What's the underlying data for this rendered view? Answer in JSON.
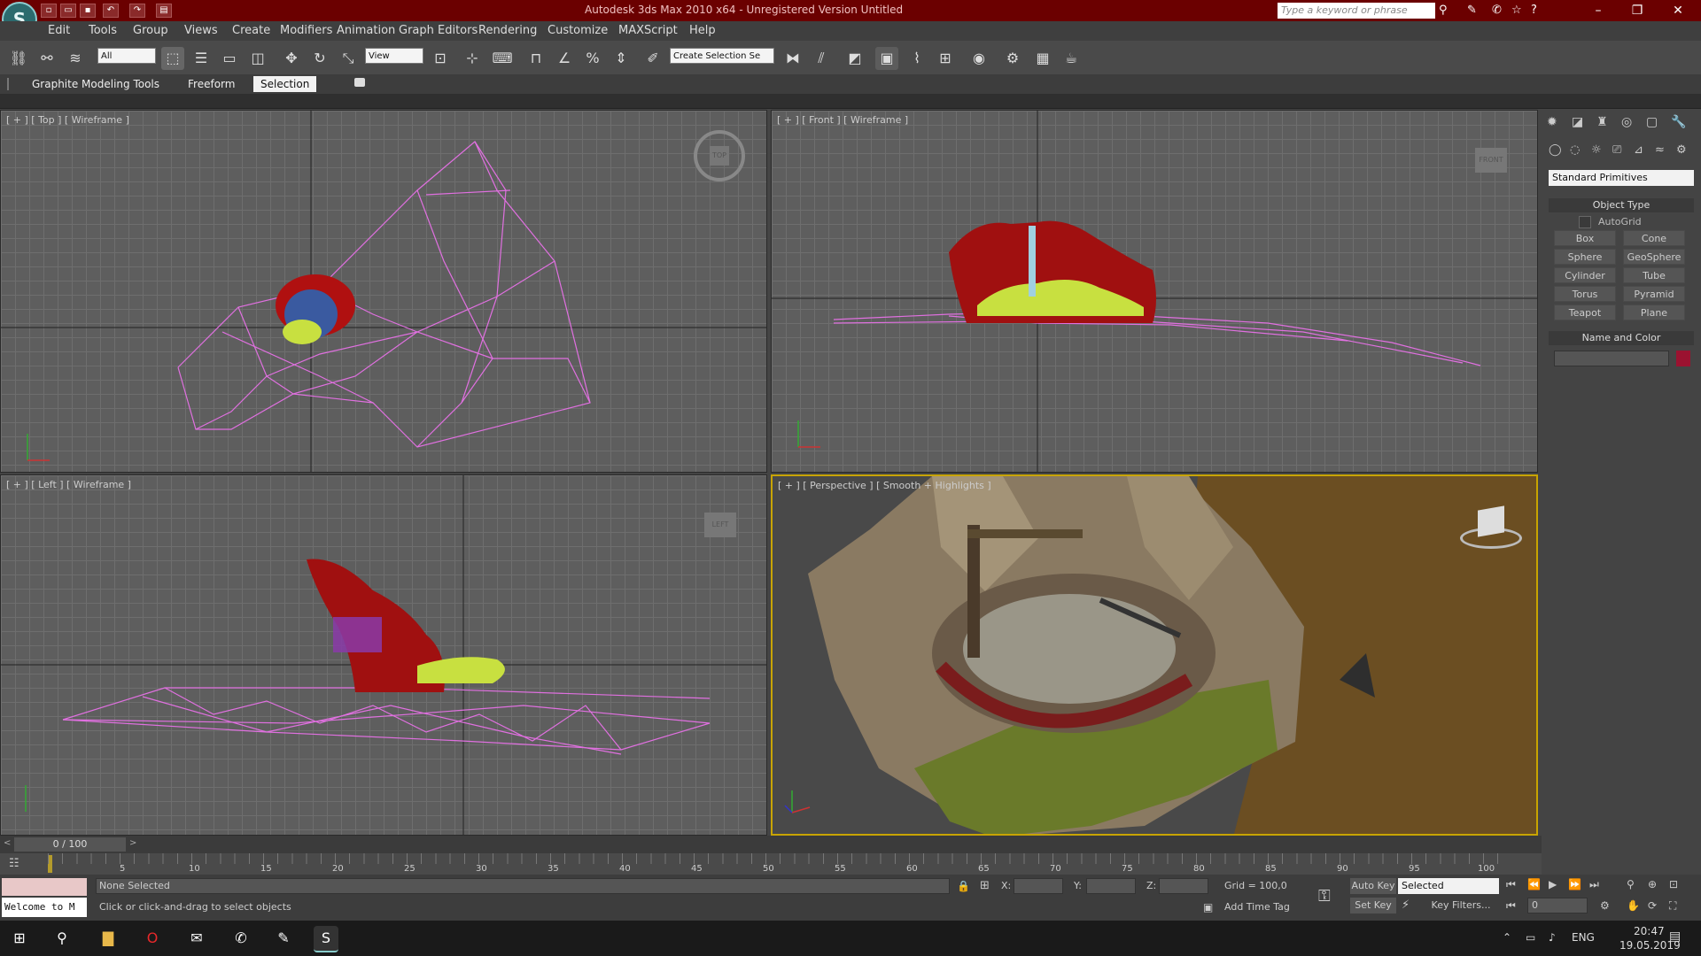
{
  "app": {
    "title": "Autodesk 3ds Max  2010 x64  -  Unregistered Version    Untitled",
    "logo": "S",
    "search_placeholder": "Type a keyword or phrase"
  },
  "window_controls": {
    "minimize": "–",
    "maximize": "❐",
    "close": "✕"
  },
  "menu": [
    "Edit",
    "Tools",
    "Group",
    "Views",
    "Create",
    "Modifiers",
    "Animation",
    "Graph Editors",
    "Rendering",
    "Customize",
    "MAXScript",
    "Help"
  ],
  "toolbar": {
    "filter_value": "All",
    "refcoord_value": "View",
    "named_selection_placeholder": "Create Selection Se"
  },
  "ribbon": {
    "tabs": [
      "Graphite Modeling Tools",
      "Freeform",
      "Selection"
    ],
    "active_tab": "Selection"
  },
  "viewports": {
    "top": "[ + ] [ Top ] [ Wireframe ]",
    "front": "[ + ] [ Front ] [ Wireframe ]",
    "left": "[ + ] [ Left ] [ Wireframe ]",
    "perspective": "[ + ] [ Perspective ] [ Smooth + Highlights ]",
    "cube_top": "TOP",
    "cube_front": "FRONT",
    "cube_left": "LEFT"
  },
  "command_panel": {
    "category": "Standard Primitives",
    "object_type_header": "Object Type",
    "autogrid_label": "AutoGrid",
    "buttons": [
      "Box",
      "Cone",
      "Sphere",
      "GeoSphere",
      "Cylinder",
      "Tube",
      "Torus",
      "Pyramid",
      "Teapot",
      "Plane"
    ],
    "name_color_header": "Name and Color",
    "object_color": "#9b1230"
  },
  "timeline": {
    "slider_text": "0 / 100",
    "ticks": [
      "5",
      "10",
      "15",
      "20",
      "25",
      "30",
      "35",
      "40",
      "45",
      "50",
      "55",
      "60",
      "65",
      "70",
      "75",
      "80",
      "85",
      "90",
      "95",
      "100"
    ]
  },
  "status": {
    "welcome": "Welcome to M",
    "selection": "None Selected",
    "prompt": "Click or click-and-drag to select objects",
    "x_label": "X:",
    "y_label": "Y:",
    "z_label": "Z:",
    "grid": "Grid = 100,0",
    "add_time_tag": "Add Time Tag",
    "auto_key": "Auto Key",
    "set_key": "Set Key",
    "key_mode": "Selected",
    "key_filters": "Key Filters...",
    "frame": "0"
  },
  "taskbar": {
    "language": "ENG",
    "time": "20:47",
    "date": "19.05.2019"
  },
  "colors": {
    "title_bar": "#6b0000",
    "wire_pink": "#e070e0",
    "scene_red": "#b01010",
    "scene_green": "#c8e040"
  }
}
